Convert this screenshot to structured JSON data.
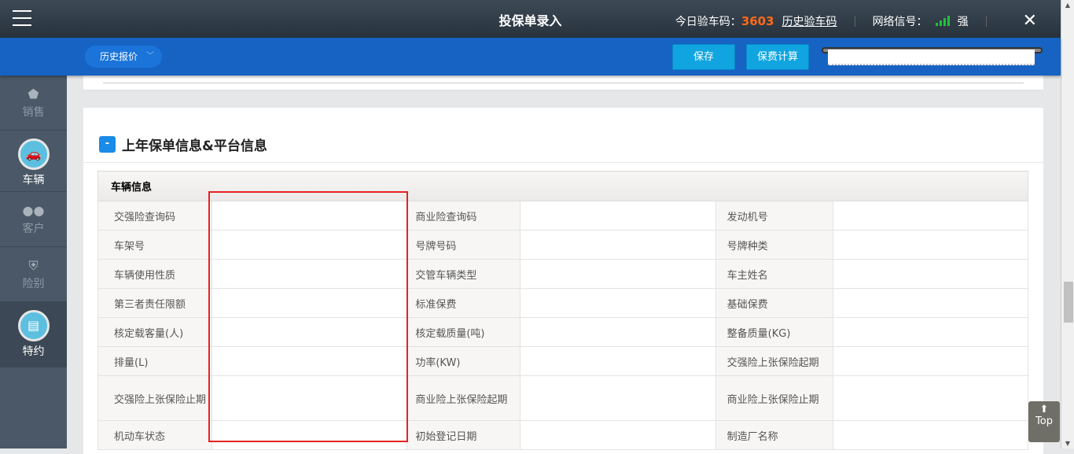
{
  "header": {
    "title": "投保单录入",
    "today_code_label": "今日验车码：",
    "today_code": "3603",
    "history_code_link": "历史验车码",
    "signal_label": "网络信号：",
    "signal_strength": "强"
  },
  "toolbar": {
    "history_quote": "历史报价",
    "save": "保存",
    "calc": "保费计算"
  },
  "sidebar": [
    {
      "label": "销售",
      "icon": "tag-icon"
    },
    {
      "label": "车辆",
      "icon": "car-icon"
    },
    {
      "label": "客户",
      "icon": "users-icon"
    },
    {
      "label": "险别",
      "icon": "shield-icon"
    },
    {
      "label": "特约",
      "icon": "document-icon"
    }
  ],
  "section": {
    "toggle": "-",
    "title": "上年保单信息&平台信息"
  },
  "table": {
    "header": "车辆信息",
    "rows": [
      [
        "交强险查询码",
        "商业险查询码",
        "发动机号"
      ],
      [
        "车架号",
        "号牌号码",
        "号牌种类"
      ],
      [
        "车辆使用性质",
        "交管车辆类型",
        "车主姓名"
      ],
      [
        "第三者责任限额",
        "标准保费",
        "基础保费"
      ],
      [
        "核定载客量(人)",
        "核定载质量(吨)",
        "整备质量(KG)"
      ],
      [
        "排量(L)",
        "功率(KW)",
        "交强险上张保险起期"
      ],
      [
        "交强险上张保险止期",
        "商业险上张保险起期",
        "商业险上张保险止期"
      ],
      [
        "机动车状态",
        "初始登记日期",
        "制造厂名称"
      ]
    ]
  },
  "top_button": "Top"
}
